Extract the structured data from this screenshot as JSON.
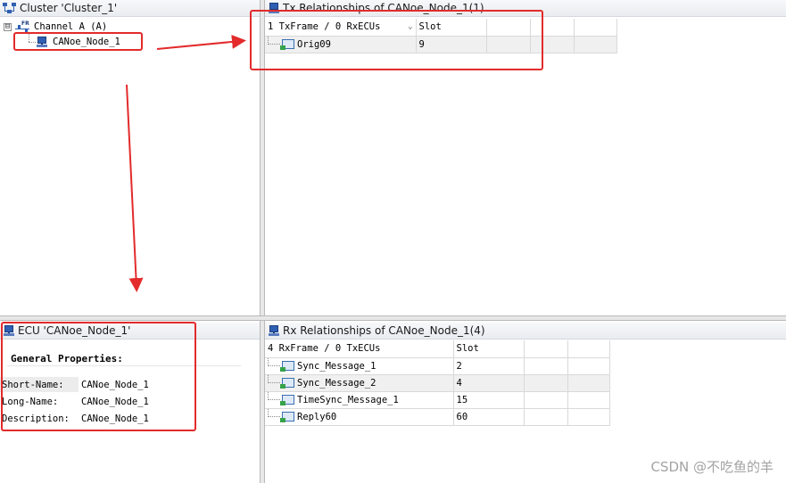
{
  "cluster_pane": {
    "title": "Cluster 'Cluster_1'",
    "channel_label": "Channel A (A)",
    "node_label": "CANoe_Node_1",
    "expander_symbol": "⊟"
  },
  "tx_pane": {
    "title": "Tx Relationships of CANoe_Node_1(1)",
    "col1_header": "1 TxFrame / 0 RxECUs",
    "col2_header": "Slot",
    "sort_symbol": "⌄",
    "rows": [
      {
        "name": "Orig09",
        "slot": "9"
      }
    ]
  },
  "ecu_pane": {
    "title": "ECU 'CANoe_Node_1'",
    "section_title": "General Properties:",
    "properties": [
      {
        "label": "Short-Name:",
        "value": "CANoe_Node_1"
      },
      {
        "label": "Long-Name:",
        "value": "CANoe_Node_1"
      },
      {
        "label": "Description:",
        "value": "CANoe_Node_1"
      }
    ]
  },
  "rx_pane": {
    "title": "Rx Relationships of CANoe_Node_1(4)",
    "col1_header": "4 RxFrame / 0 TxECUs",
    "col2_header": "Slot",
    "rows": [
      {
        "name": "Sync_Message_1",
        "slot": "2"
      },
      {
        "name": "Sync_Message_2",
        "slot": "4"
      },
      {
        "name": "TimeSync_Message_1",
        "slot": "15"
      },
      {
        "name": "Reply60",
        "slot": "60"
      }
    ]
  },
  "watermark": "CSDN @不吃鱼的羊",
  "colors": {
    "annotation_red": "#e32b2b",
    "icon_blue": "#2f5fb3",
    "row_alt": "#f0f0f0"
  }
}
